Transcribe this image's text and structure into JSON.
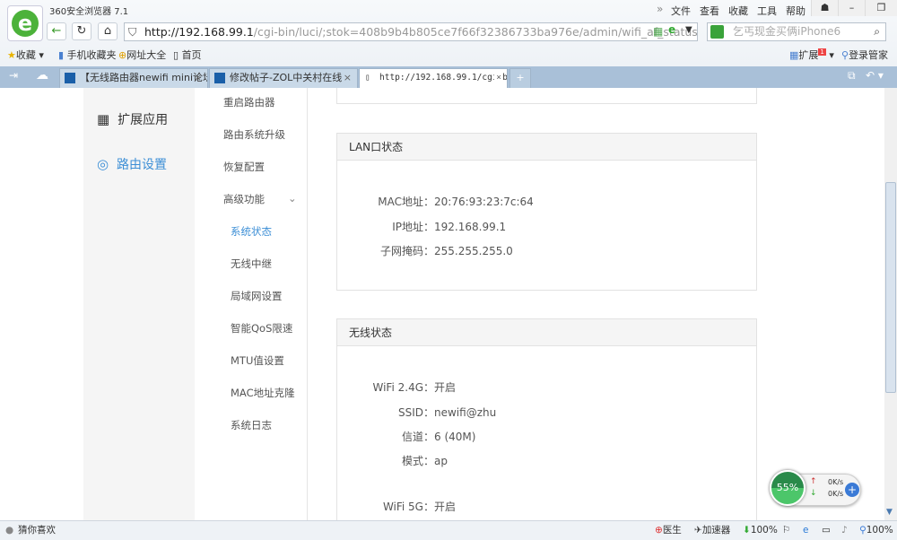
{
  "browser": {
    "title": "360安全浏览器 7.1",
    "menu": [
      "文件",
      "查看",
      "收藏",
      "工具",
      "帮助"
    ],
    "address_host": "http://192.168.99.1",
    "address_path": "/cgi-bin/luci/;stok=408b9b4b805ce7f66f32386733ba976e/admin/wifi_af_status",
    "search_placeholder": "乞丐现金买俩iPhone6",
    "favorites": [
      "收藏",
      "手机收藏夹",
      "网址大全",
      "首页"
    ],
    "extensions": "扩展",
    "ext_badge": "1",
    "login": "登录管家",
    "tabs": [
      "【无线路由器newifi mini论坛",
      "修改帖子-ZOL中关村在线",
      "http://192.168.99.1/cgi-bin"
    ]
  },
  "sidebar": {
    "items": [
      "扩展应用",
      "路由设置"
    ]
  },
  "submenu": {
    "items": [
      "重启路由器",
      "路由系统升级",
      "恢复配置",
      "高级功能"
    ],
    "advanced": [
      "系统状态",
      "无线中继",
      "局域网设置",
      "智能QoS限速",
      "MTU值设置",
      "MAC地址克隆",
      "系统日志"
    ]
  },
  "lan": {
    "title": "LAN口状态",
    "rows": [
      {
        "k": "MAC地址：",
        "v": "20:76:93:23:7c:64"
      },
      {
        "k": "IP地址：",
        "v": "192.168.99.1"
      },
      {
        "k": "子网掩码：",
        "v": "255.255.255.0"
      }
    ]
  },
  "wireless": {
    "title": "无线状态",
    "rows": [
      {
        "k": "WiFi 2.4G：",
        "v": "开启"
      },
      {
        "k": "SSID：",
        "v": "newifi@zhu"
      },
      {
        "k": "信道：",
        "v": "6 (40M)"
      },
      {
        "k": "模式：",
        "v": "ap"
      },
      {
        "k": "WiFi 5G：",
        "v": "开启"
      }
    ]
  },
  "speed": {
    "percent": "55%",
    "up": "0K/s",
    "down": "0K/s"
  },
  "status": {
    "left": "猜你喜欢",
    "doctor": "医生",
    "accel": "加速器",
    "download": "100%",
    "zoom": "100%"
  }
}
